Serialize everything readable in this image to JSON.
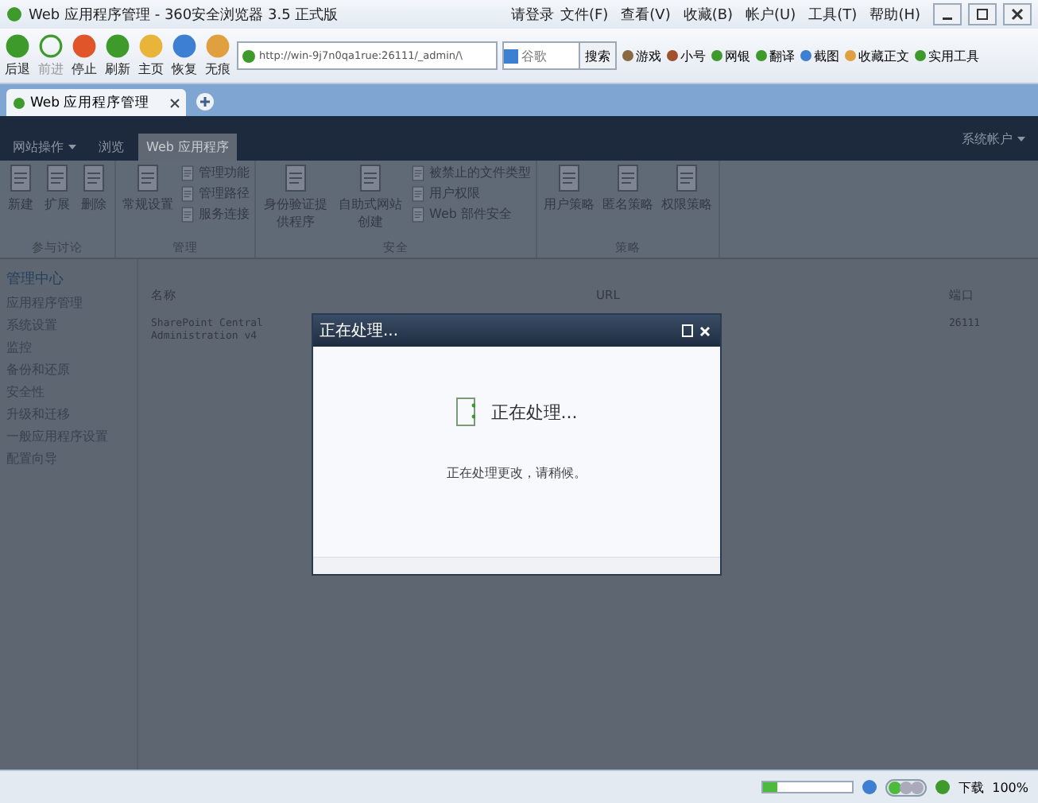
{
  "window": {
    "title": "Web 应用程序管理 - 360安全浏览器 3.5 正式版",
    "login": "请登录",
    "menu": [
      "文件(F)",
      "查看(V)",
      "收藏(B)",
      "帐户(U)",
      "工具(T)",
      "帮助(H)"
    ]
  },
  "toolbar": {
    "nav": [
      {
        "label": "后退",
        "color": "#3f9a2c",
        "disabled": false
      },
      {
        "label": "前进",
        "color": "#3f9a2c",
        "disabled": true
      },
      {
        "label": "停止",
        "color": "#e0552a",
        "disabled": false
      },
      {
        "label": "刷新",
        "color": "#3f9a2c",
        "disabled": false
      },
      {
        "label": "主页",
        "color": "#e8b43a",
        "disabled": false
      },
      {
        "label": "恢复",
        "color": "#3d7fd0",
        "disabled": false
      },
      {
        "label": "无痕",
        "color": "#e0a040",
        "disabled": false
      }
    ],
    "address": "http://win-9j7n0qa1rue:26111/_admin/\\",
    "search": {
      "placeholder": "谷歌",
      "button": "搜索"
    },
    "links": [
      {
        "label": "游戏",
        "color": "#8a6a40"
      },
      {
        "label": "小号",
        "color": "#a0522d"
      },
      {
        "label": "网银",
        "color": "#3f9a2c"
      },
      {
        "label": "翻译",
        "color": "#3f9a2c"
      },
      {
        "label": "截图",
        "color": "#3d7fd0"
      },
      {
        "label": "收藏正文",
        "color": "#e0a040"
      },
      {
        "label": "实用工具",
        "color": "#3f9a2c"
      }
    ]
  },
  "tabs": [
    {
      "label": "Web 应用程序管理",
      "selected": true
    }
  ],
  "sharepoint": {
    "site_actions": "网站操作",
    "ribbon_tabs": [
      {
        "label": "浏览",
        "selected": false
      },
      {
        "label": "Web 应用程序",
        "selected": true
      }
    ],
    "user": "系统帐户",
    "ribbon_groups": [
      {
        "name": "参与讨论",
        "items": [
          {
            "kind": "large",
            "label": "新建"
          },
          {
            "kind": "large",
            "label": "扩展"
          },
          {
            "kind": "large",
            "label": "删除"
          }
        ]
      },
      {
        "name": "管理",
        "items": [
          {
            "kind": "large",
            "label": "常规设置"
          },
          {
            "kind": "small",
            "label": "管理功能"
          },
          {
            "kind": "small",
            "label": "管理路径"
          },
          {
            "kind": "small",
            "label": "服务连接"
          }
        ]
      },
      {
        "name": "安全",
        "items": [
          {
            "kind": "large",
            "label": "身份验证提供程序"
          },
          {
            "kind": "large",
            "label": "自助式网站创建"
          },
          {
            "kind": "small",
            "label": "被禁止的文件类型"
          },
          {
            "kind": "small",
            "label": "用户权限"
          },
          {
            "kind": "small",
            "label": "Web 部件安全"
          }
        ]
      },
      {
        "name": "策略",
        "items": [
          {
            "kind": "large",
            "label": "用户策略"
          },
          {
            "kind": "large",
            "label": "匿名策略"
          },
          {
            "kind": "large",
            "label": "权限策略"
          }
        ]
      }
    ],
    "nav": [
      "管理中心",
      "应用程序管理",
      "系统设置",
      "监控",
      "备份和还原",
      "安全性",
      "升级和迁移",
      "一般应用程序设置",
      "配置向导"
    ],
    "table": {
      "columns": [
        "名称",
        "URL",
        "端口"
      ],
      "rows": [
        [
          "SharePoint Central Administration v4",
          "",
          "26111"
        ]
      ]
    }
  },
  "dialog": {
    "title": "正在处理...",
    "heading": "正在处理...",
    "message": "正在处理更改，请稍候。"
  },
  "status_bar": {
    "level": 0.15,
    "download": "下载",
    "zoom": "100%"
  }
}
